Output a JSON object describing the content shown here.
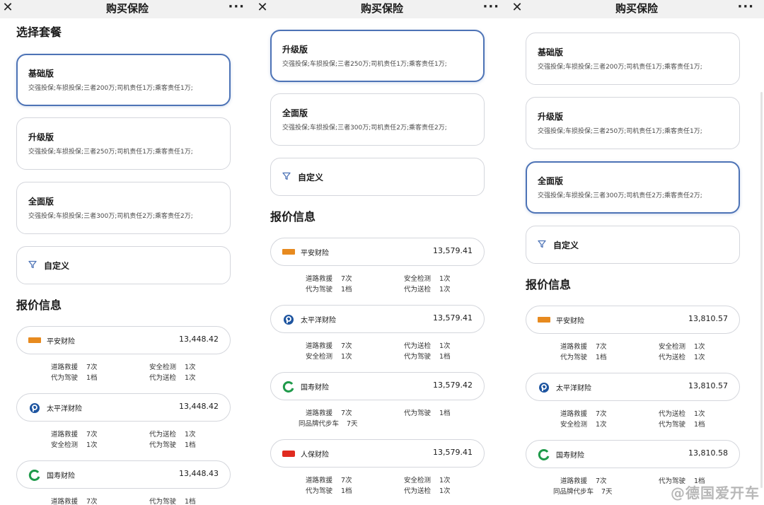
{
  "title": "购买保险",
  "close_glyph": "✕",
  "more_glyph": "···",
  "section_plans": "选择套餐",
  "section_quotes": "报价信息",
  "custom_label": "自定义",
  "plans": {
    "basic": {
      "name": "基础版",
      "desc": "交强投保;车损投保;三者200万;司机责任1万;乘客责任1万;"
    },
    "upgrade": {
      "name": "升级版",
      "desc": "交强投保;车损投保;三者250万;司机责任1万;乘客责任1万;"
    },
    "full": {
      "name": "全面版",
      "desc": "交强投保;车损投保;三者300万;司机责任2万;乘客责任2万;"
    }
  },
  "panels": [
    {
      "selected_plan": "basic",
      "quotes": [
        {
          "name": "平安财险",
          "logo": "pingan-logo",
          "price": "13,448.42",
          "services": [
            [
              "道路救援",
              "7次"
            ],
            [
              "安全检测",
              "1次"
            ],
            [
              "代为驾驶",
              "1档"
            ],
            [
              "代为送检",
              "1次"
            ]
          ]
        },
        {
          "name": "太平洋财险",
          "logo": "cpic-logo",
          "price": "13,448.42",
          "services": [
            [
              "道路救援",
              "7次"
            ],
            [
              "代为送检",
              "1次"
            ],
            [
              "安全检测",
              "1次"
            ],
            [
              "代为驾驶",
              "1档"
            ]
          ]
        },
        {
          "name": "国寿财险",
          "logo": "chinalife-logo",
          "price": "13,448.43",
          "services": [
            [
              "道路救援",
              "7次"
            ],
            [
              "代为驾驶",
              "1档"
            ]
          ]
        }
      ]
    },
    {
      "selected_plan": "upgrade",
      "quotes": [
        {
          "name": "平安财险",
          "logo": "pingan-logo",
          "price": "13,579.41",
          "services": [
            [
              "道路救援",
              "7次"
            ],
            [
              "安全检测",
              "1次"
            ],
            [
              "代为驾驶",
              "1档"
            ],
            [
              "代为送检",
              "1次"
            ]
          ]
        },
        {
          "name": "太平洋财险",
          "logo": "cpic-logo",
          "price": "13,579.41",
          "services": [
            [
              "道路救援",
              "7次"
            ],
            [
              "代为送检",
              "1次"
            ],
            [
              "安全检测",
              "1次"
            ],
            [
              "代为驾驶",
              "1档"
            ]
          ]
        },
        {
          "name": "国寿财险",
          "logo": "chinalife-logo",
          "price": "13,579.42",
          "services": [
            [
              "道路救援",
              "7次"
            ],
            [
              "代为驾驶",
              "1档"
            ],
            [
              "同品牌代步车",
              "7天"
            ]
          ]
        },
        {
          "name": "人保财险",
          "logo": "picc-logo",
          "price": "13,579.41",
          "services": [
            [
              "道路救援",
              "7次"
            ],
            [
              "安全检测",
              "1次"
            ],
            [
              "代为驾驶",
              "1档"
            ],
            [
              "代为送检",
              "1次"
            ]
          ]
        }
      ]
    },
    {
      "selected_plan": "full",
      "quotes": [
        {
          "name": "平安财险",
          "logo": "pingan-logo",
          "price": "13,810.57",
          "services": [
            [
              "道路救援",
              "7次"
            ],
            [
              "安全检测",
              "1次"
            ],
            [
              "代为驾驶",
              "1档"
            ],
            [
              "代为送检",
              "1次"
            ]
          ]
        },
        {
          "name": "太平洋财险",
          "logo": "cpic-logo",
          "price": "13,810.57",
          "services": [
            [
              "道路救援",
              "7次"
            ],
            [
              "代为送检",
              "1次"
            ],
            [
              "安全检测",
              "1次"
            ],
            [
              "代为驾驶",
              "1档"
            ]
          ]
        },
        {
          "name": "国寿财险",
          "logo": "chinalife-logo",
          "price": "13,810.58",
          "services": [
            [
              "道路救援",
              "7次"
            ],
            [
              "代为驾驶",
              "1档"
            ],
            [
              "同品牌代步车",
              "7天"
            ]
          ]
        }
      ]
    }
  ],
  "watermark": "@德国爱开车",
  "colors": {
    "accent": "#4d73b6",
    "border": "#d4d6dc",
    "topbar": "#f1f1f1"
  }
}
